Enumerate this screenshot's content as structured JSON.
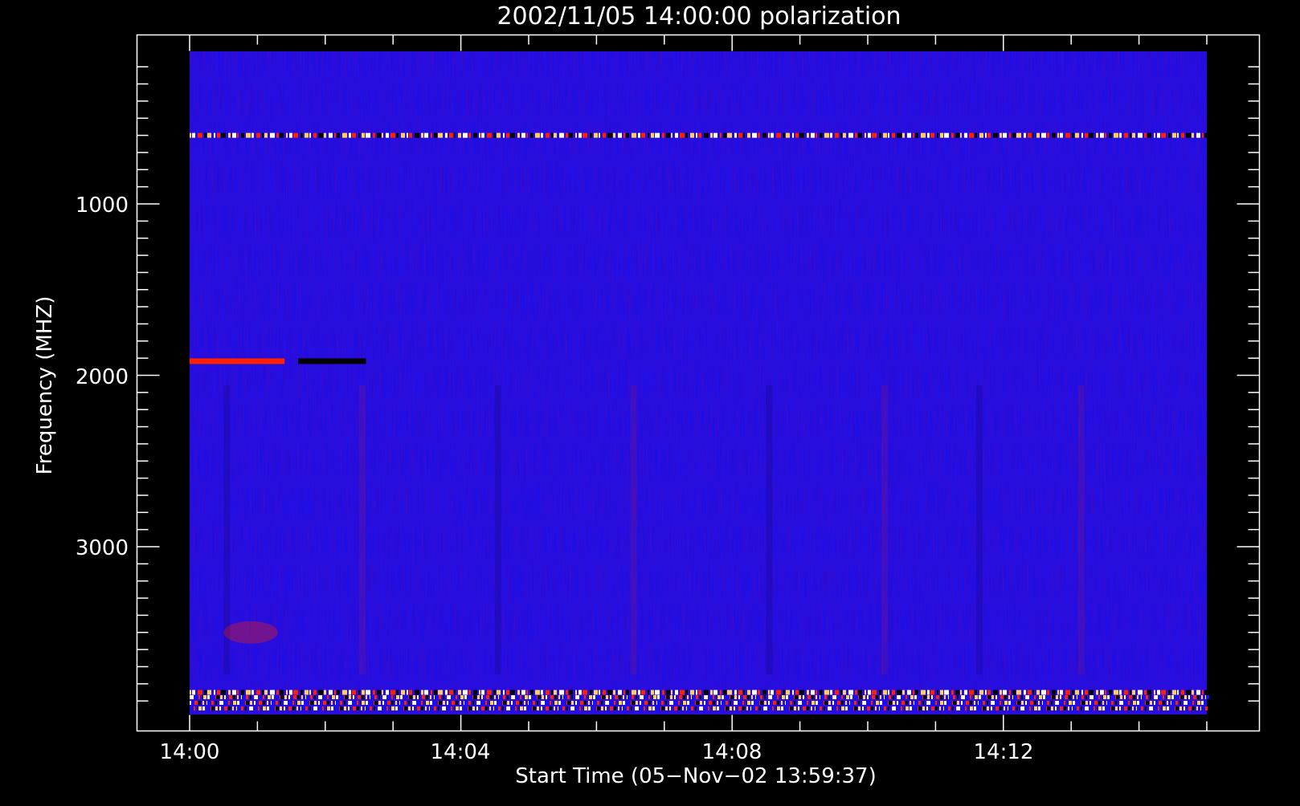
{
  "chart_data": {
    "type": "heatmap",
    "title": "2002/11/05 14:00:00 polarization",
    "xlabel": "Start Time (05−Nov−02 13:59:37)",
    "ylabel": "Frequency (MHZ)",
    "x_ticks": [
      {
        "label": "14:00",
        "minute": 0
      },
      {
        "label": "14:04",
        "minute": 4
      },
      {
        "label": "14:08",
        "minute": 8
      },
      {
        "label": "14:12",
        "minute": 12
      }
    ],
    "y_ticks": [
      {
        "label": "1000",
        "value": 1000
      },
      {
        "label": "2000",
        "value": 2000
      },
      {
        "label": "3000",
        "value": 3000
      }
    ],
    "x_range_minutes": [
      0,
      15
    ],
    "y_range_mhz": [
      100,
      4000
    ],
    "y_axis_inverted": true,
    "grid": false,
    "colormap": {
      "low": "#000000",
      "mid": "#1010ff",
      "high": "#ff2000",
      "peak": "#ffd060"
    },
    "features": [
      {
        "kind": "horizontal-band",
        "freq_mhz": 1920,
        "start_min": 0.0,
        "end_min": 1.4,
        "level": "high"
      },
      {
        "kind": "horizontal-band",
        "freq_mhz": 1920,
        "start_min": 1.6,
        "end_min": 2.6,
        "level": "low"
      },
      {
        "kind": "horizontal-band",
        "freq_mhz": 3850,
        "start_min": 0.0,
        "end_min": 15.0,
        "level": "interference"
      },
      {
        "kind": "horizontal-band",
        "freq_mhz": 600,
        "start_min": 0.0,
        "end_min": 15.0,
        "level": "interference"
      },
      {
        "kind": "patch",
        "freq_mhz": 3500,
        "start_min": 0.5,
        "end_min": 1.3,
        "level": "high"
      }
    ]
  }
}
